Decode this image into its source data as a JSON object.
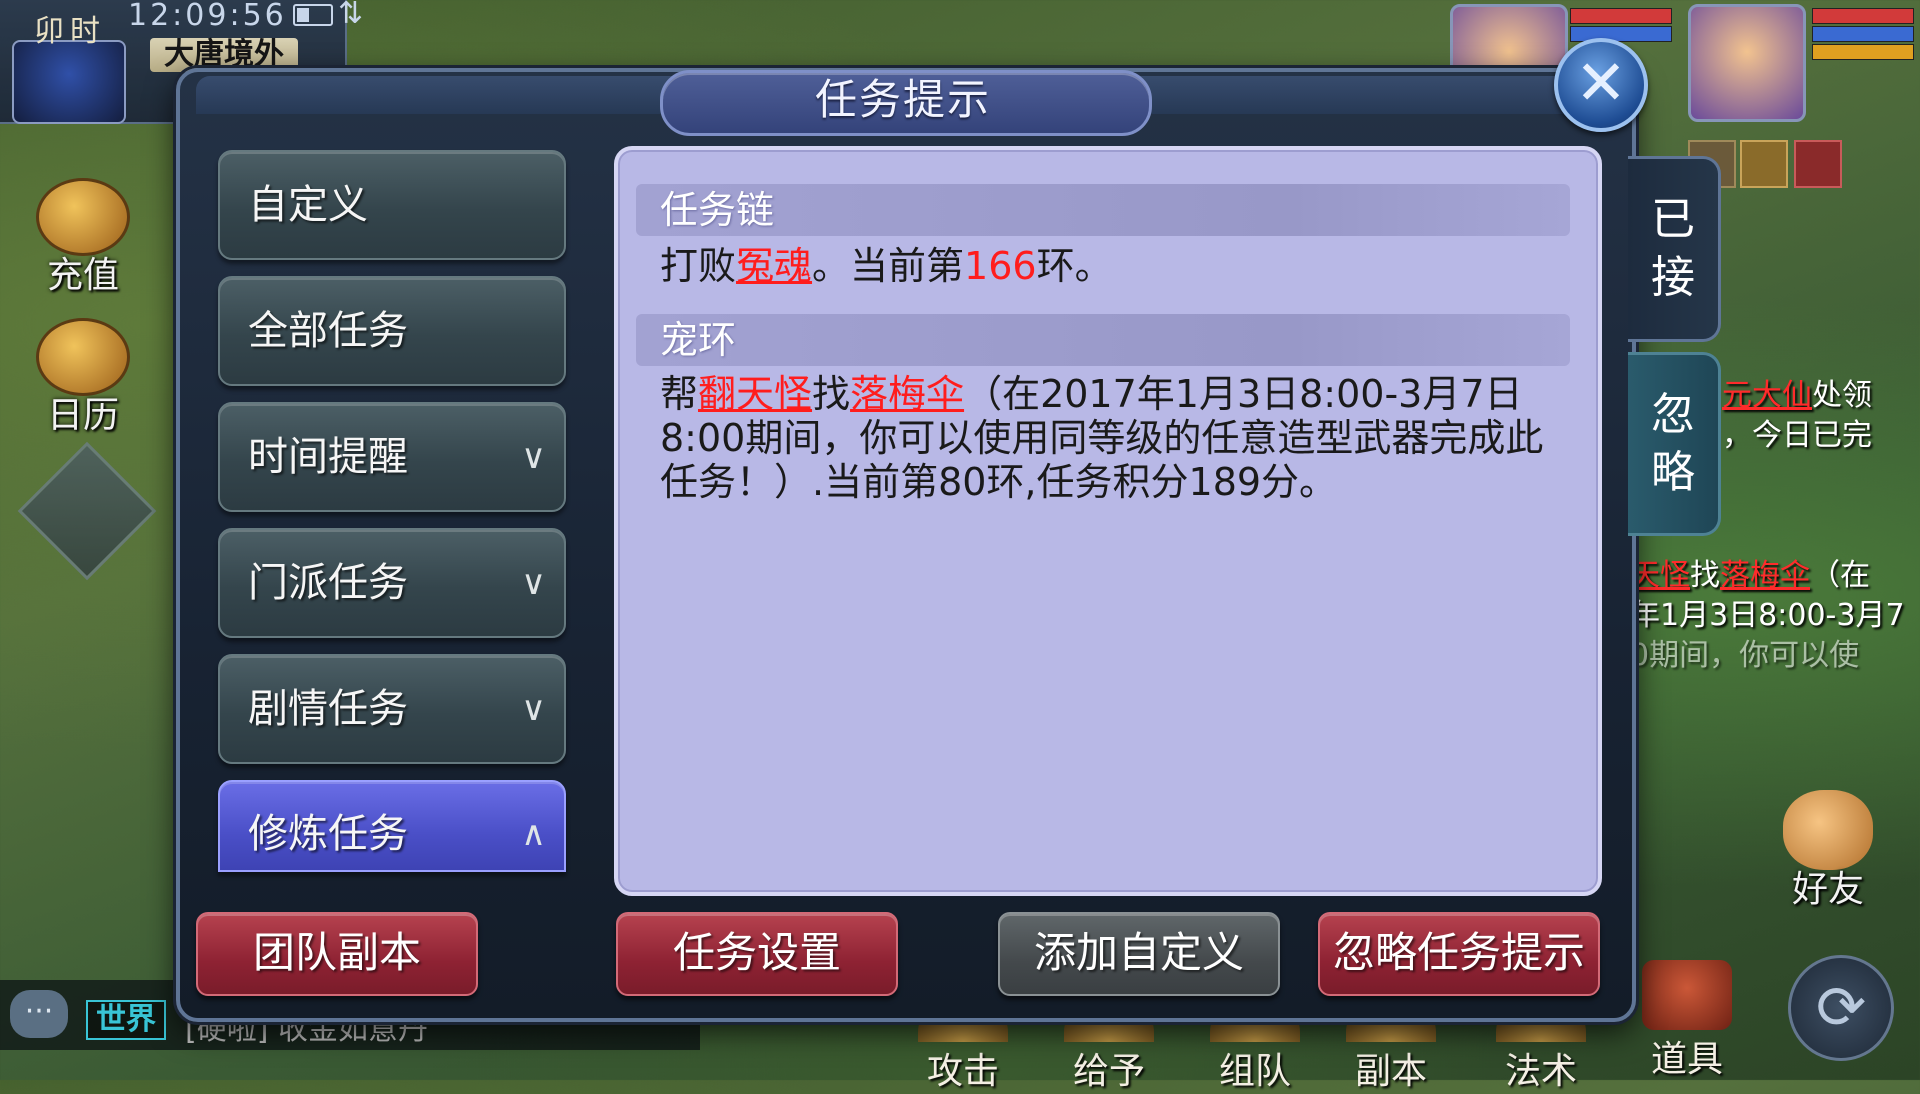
{
  "hud": {
    "shichen": "卯时",
    "time": "12:09:56",
    "location": "大唐境外",
    "side_buttons": [
      {
        "label": "充值",
        "icon": "coin-chest-icon"
      },
      {
        "label": "日历",
        "icon": "calendar-dial-icon"
      }
    ]
  },
  "dialog": {
    "title": "任务提示",
    "categories": [
      {
        "label": "自定义",
        "expand": ""
      },
      {
        "label": "全部任务",
        "expand": ""
      },
      {
        "label": "时间提醒",
        "expand": "∨"
      },
      {
        "label": "门派任务",
        "expand": "∨"
      },
      {
        "label": "剧情任务",
        "expand": "∨"
      },
      {
        "label": "修炼任务",
        "expand": "∧",
        "selected": true
      }
    ],
    "sections": [
      {
        "title": "任务链",
        "body": {
          "pre": "打败",
          "target": "冤魂",
          "mid": "。当前第",
          "ring": "166",
          "post": "环。"
        }
      },
      {
        "title": "宠环",
        "body": {
          "pre": "帮",
          "npc": "翻天怪",
          "mid": "找",
          "item": "落梅伞",
          "post": "（在2017年1月3日8:00-3月7日8:00期间，你可以使用同等级的任意造型武器完成此任务！）.当前第80环,任务积分189分。"
        }
      }
    ],
    "tabs": [
      {
        "label": "已接",
        "active": true
      },
      {
        "label": "忽略",
        "active": false
      }
    ],
    "buttons": {
      "team_dungeon": "团队副本",
      "task_settings": "任务设置",
      "add_custom": "添加自定义",
      "ignore_hint": "忽略任务提示"
    }
  },
  "background_tracker": {
    "line1_red": "元大仙",
    "line1_rest": "处领",
    "line2": "，今日已完",
    "line3_red1": "天怪",
    "line3_mid": "找",
    "line3_red2": "落梅伞",
    "line3_rest": "（在",
    "line4": "年1月3日8:00-3月7",
    "line5": "0期间，你可以使"
  },
  "chat": {
    "icon": "chat-bubble-icon",
    "channel": "世界",
    "message": "[硬啦] 收金如意丹"
  },
  "friend_label": "好友",
  "action_bar": [
    "攻击",
    "给予",
    "组队",
    "副本",
    "法术",
    "道具"
  ],
  "colors": {
    "highlight_red": "#ff1d1d",
    "panel_bg": "#b8b8e6",
    "selected_tab": "#4a4fc7",
    "red_button": "#8e2233"
  }
}
